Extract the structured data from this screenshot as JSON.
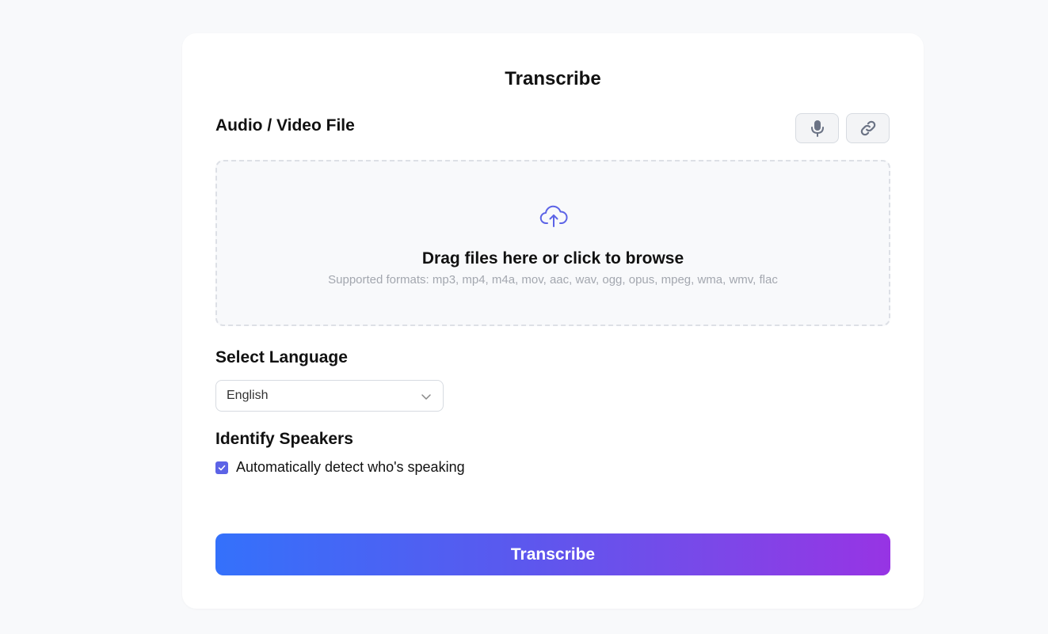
{
  "page": {
    "title": "Transcribe"
  },
  "file_section": {
    "label": "Audio / Video File",
    "record_button_icon": "microphone-icon",
    "url_button_icon": "link-icon"
  },
  "dropzone": {
    "icon": "cloud-upload-icon",
    "title": "Drag files here or click to browse",
    "formats": "Supported formats: mp3, mp4, m4a, mov, aac, wav, ogg, opus, mpeg, wma, wmv, flac"
  },
  "language": {
    "label": "Select Language",
    "selected": "English"
  },
  "speakers": {
    "label": "Identify Speakers",
    "checkbox_label": "Automatically detect who's speaking",
    "checked": true
  },
  "submit": {
    "label": "Transcribe"
  },
  "colors": {
    "accent": "#5c63e6",
    "gradient_start": "#3471fb",
    "gradient_end": "#9734e4",
    "icon_gray": "#6b7385"
  }
}
